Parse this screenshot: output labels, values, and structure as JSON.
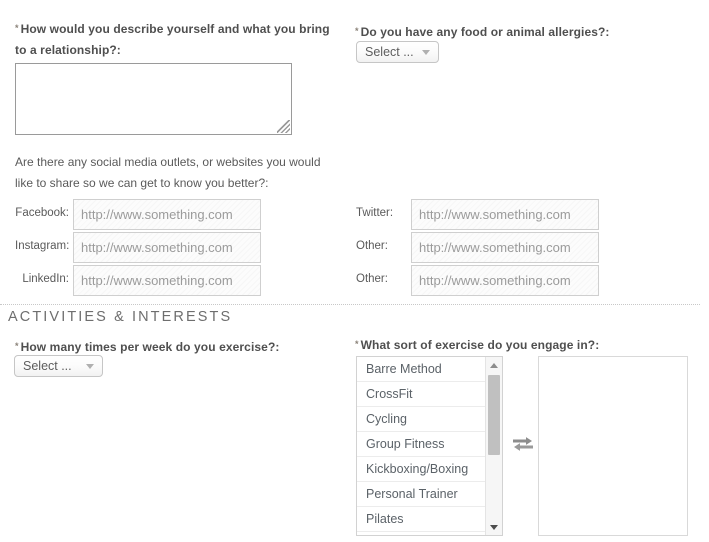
{
  "form": {
    "describe_question": "How would you describe yourself and what you bring to a relationship?:",
    "describe_value": "",
    "allergies_question": "Do you have any food or animal allergies?:",
    "allergies_selected": "Select ...",
    "social_intro": "Are there any social media outlets, or websites you would like to share so we can get to know you better?:",
    "social_fields_left": [
      {
        "label": "Facebook:",
        "placeholder": "http://www.something.com",
        "value": ""
      },
      {
        "label": "Instagram:",
        "placeholder": "http://www.something.com",
        "value": ""
      },
      {
        "label": "LinkedIn:",
        "placeholder": "http://www.something.com",
        "value": ""
      }
    ],
    "social_fields_right": [
      {
        "label": "Twitter:",
        "placeholder": "http://www.something.com",
        "value": ""
      },
      {
        "label": "Other:",
        "placeholder": "http://www.something.com",
        "value": ""
      },
      {
        "label": "Other:",
        "placeholder": "http://www.something.com",
        "value": ""
      }
    ]
  },
  "activities": {
    "section_title": "ACTIVITIES & INTERESTS",
    "frequency_question": "How many times per week do you exercise?:",
    "frequency_selected": "Select ...",
    "exercise_question": "What sort of exercise do you engage in?:",
    "exercise_options": [
      "Barre Method",
      "CrossFit",
      "Cycling",
      "Group Fitness",
      "Kickboxing/Boxing",
      "Personal Trainer",
      "Pilates"
    ],
    "exercise_selected": [],
    "transfer_icon": "left-right-arrows-icon"
  },
  "icons": {
    "required_marker": "*",
    "dropdown_caret": "chevron-down-icon",
    "scroll_up": "triangle-up-icon",
    "scroll_down": "triangle-down-icon"
  },
  "colors": {
    "label_text": "#4f4f4f",
    "placeholder_text": "#9b9b9b",
    "section_title": "#6e6e6e",
    "border": "#cfcfcf",
    "required_marker": "#8a8278"
  }
}
